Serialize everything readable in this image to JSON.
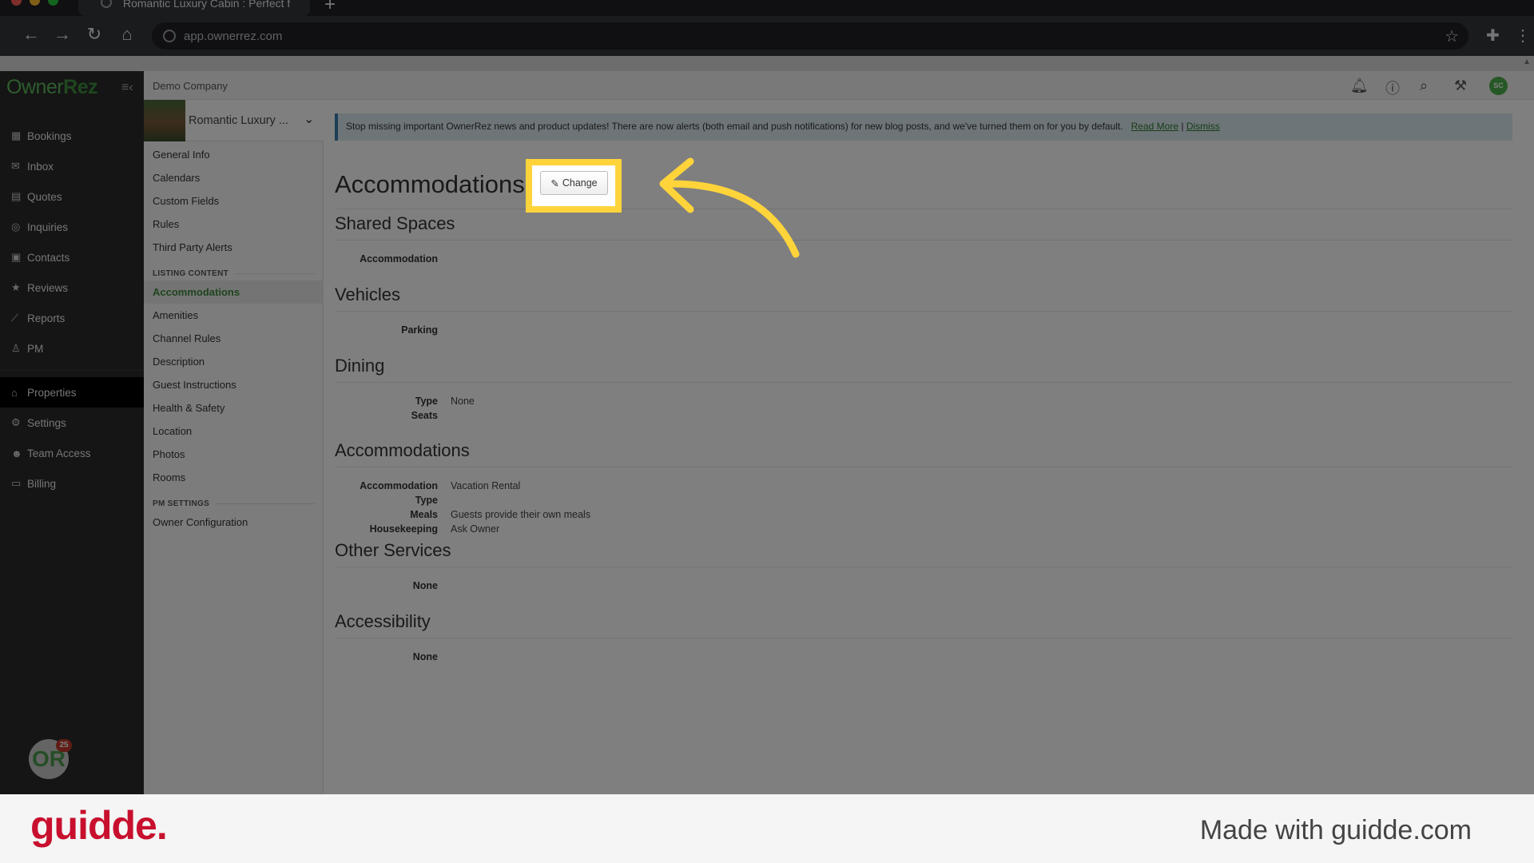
{
  "browser": {
    "tab_title": "Romantic Luxury Cabin : Perfect f",
    "url": "app.ownerrez.com"
  },
  "app": {
    "logo_text_light": "Owner",
    "logo_text_bold": "Rez",
    "company": "Demo Company",
    "user_initials": "SC",
    "badge_text": "OR",
    "badge_count": "25"
  },
  "sidebar": {
    "items": [
      {
        "label": "Bookings",
        "icon": "calendar-icon"
      },
      {
        "label": "Inbox",
        "icon": "envelope-icon"
      },
      {
        "label": "Quotes",
        "icon": "document-icon"
      },
      {
        "label": "Inquiries",
        "icon": "chat-icon"
      },
      {
        "label": "Contacts",
        "icon": "address-book-icon"
      },
      {
        "label": "Reviews",
        "icon": "star-icon"
      },
      {
        "label": "Reports",
        "icon": "chart-icon"
      },
      {
        "label": "PM",
        "icon": "person-icon"
      }
    ],
    "items2": [
      {
        "label": "Properties",
        "icon": "home-icon"
      },
      {
        "label": "Settings",
        "icon": "gear-icon"
      },
      {
        "label": "Team Access",
        "icon": "team-icon"
      },
      {
        "label": "Billing",
        "icon": "card-icon"
      }
    ]
  },
  "property": {
    "name": "Romantic Luxury ..."
  },
  "subnav": {
    "general": [
      "General Info",
      "Calendars",
      "Custom Fields",
      "Rules",
      "Third Party Alerts"
    ],
    "listing_header": "LISTING CONTENT",
    "listing": [
      "Accommodations",
      "Amenities",
      "Channel Rules",
      "Description",
      "Guest Instructions",
      "Health & Safety",
      "Location",
      "Photos",
      "Rooms"
    ],
    "pm_header": "PM SETTINGS",
    "pm": [
      "Owner Configuration"
    ]
  },
  "alert": {
    "text": "Stop missing important OwnerRez news and product updates! There are now alerts (both email and push notifications) for new blog posts, and we've turned them on for you by default.",
    "read_more": "Read More",
    "separator": "|",
    "dismiss": "Dismiss"
  },
  "main": {
    "title": "Accommodations",
    "change_label": "Change",
    "sections": [
      {
        "title": "Shared Spaces",
        "rows": [
          {
            "k": "Accommodation",
            "v": ""
          }
        ]
      },
      {
        "title": "Vehicles",
        "rows": [
          {
            "k": "Parking",
            "v": ""
          }
        ]
      },
      {
        "title": "Dining",
        "rows": [
          {
            "k": "Type",
            "v": "None"
          },
          {
            "k": "Seats",
            "v": ""
          }
        ]
      },
      {
        "title": "Accommodations",
        "rows": [
          {
            "k": "Accommodation Type",
            "v": "Vacation Rental"
          },
          {
            "k": "Meals",
            "v": "Guests provide their own meals"
          },
          {
            "k": "Housekeeping",
            "v": "Ask Owner"
          }
        ]
      },
      {
        "title": "Other Services",
        "rows": [
          {
            "k": "None",
            "v": ""
          }
        ]
      },
      {
        "title": "Accessibility",
        "rows": [
          {
            "k": "None",
            "v": ""
          }
        ]
      }
    ]
  },
  "footer": {
    "logo": "guidde.",
    "made_with": "Made with guidde.com"
  },
  "colors": {
    "highlight": "#ffd43b",
    "brand_green": "#5cb85c",
    "guidde_red": "#c8102e"
  }
}
